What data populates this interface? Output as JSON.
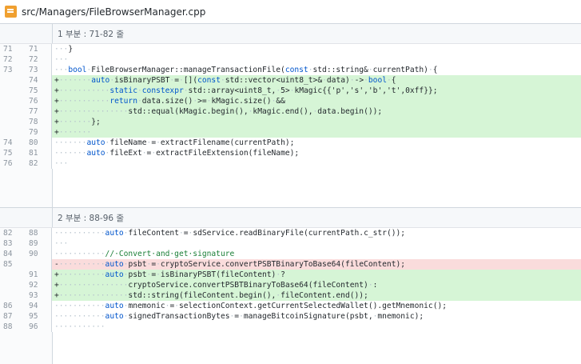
{
  "file": {
    "path": "src/Managers/FileBrowserManager.cpp"
  },
  "hunks": [
    {
      "title": "1 부분 : 71-82 줄",
      "rows": [
        {
          "old": "71",
          "new": "71",
          "type": "ctx",
          "code": "···}"
        },
        {
          "old": "72",
          "new": "72",
          "type": "ctx",
          "code": "···"
        },
        {
          "old": "73",
          "new": "73",
          "type": "ctx",
          "code": "···bool·FileBrowserManager::manageTransactionFile(const·std::string&·currentPath)·{"
        },
        {
          "old": "",
          "new": "74",
          "type": "add",
          "code": "+·······auto·isBinaryPSBT·=·[](const·std::vector<uint8_t>&·data)·->·bool·{"
        },
        {
          "old": "",
          "new": "75",
          "type": "add",
          "code": "+···········static·constexpr·std::array<uint8_t,·5>·kMagic{{'p','s','b','t',0xff}};"
        },
        {
          "old": "",
          "new": "76",
          "type": "add",
          "code": "+···········return·data.size()·>=·kMagic.size()·&&"
        },
        {
          "old": "",
          "new": "77",
          "type": "add",
          "code": "+···············std::equal(kMagic.begin(),·kMagic.end(),·data.begin());"
        },
        {
          "old": "",
          "new": "78",
          "type": "add",
          "code": "+·······};"
        },
        {
          "old": "",
          "new": "79",
          "type": "add",
          "code": "+·······"
        },
        {
          "old": "74",
          "new": "80",
          "type": "ctx",
          "code": "·······auto·fileName·=·extractFilename(currentPath);"
        },
        {
          "old": "75",
          "new": "81",
          "type": "ctx",
          "code": "·······auto·fileExt·=·extractFileExtension(fileName);"
        },
        {
          "old": "76",
          "new": "82",
          "type": "ctx",
          "code": "···"
        }
      ]
    },
    {
      "title": "2 부분 : 88-96 줄",
      "rows": [
        {
          "old": "82",
          "new": "88",
          "type": "ctx",
          "code": "···········auto·fileContent·=·sdService.readBinaryFile(currentPath.c_str());"
        },
        {
          "old": "83",
          "new": "89",
          "type": "ctx",
          "code": "···"
        },
        {
          "old": "84",
          "new": "90",
          "type": "ctx",
          "code": "···········//·Convert·and·get·signature"
        },
        {
          "old": "85",
          "new": "",
          "type": "del",
          "code": "-··········auto·psbt·=·cryptoService.convertPSBTBinaryToBase64(fileContent);"
        },
        {
          "old": "",
          "new": "91",
          "type": "add",
          "code": "+··········auto·psbt·=·isBinaryPSBT(fileContent)·?"
        },
        {
          "old": "",
          "new": "92",
          "type": "add",
          "code": "+···············cryptoService.convertPSBTBinaryToBase64(fileContent)·:"
        },
        {
          "old": "",
          "new": "93",
          "type": "add",
          "code": "+···············std::string(fileContent.begin(),·fileContent.end());"
        },
        {
          "old": "86",
          "new": "94",
          "type": "ctx",
          "code": "···········auto·mnemonic·=·selectionContext.getCurrentSelectedWallet().getMnemonic();"
        },
        {
          "old": "87",
          "new": "95",
          "type": "ctx",
          "code": "···········auto·signedTransactionBytes·=·manageBitcoinSignature(psbt,·mnemonic);"
        },
        {
          "old": "88",
          "new": "96",
          "type": "ctx",
          "code": "···········"
        }
      ]
    }
  ],
  "colors": {
    "add_bg": "#d6f5d6",
    "del_bg": "#fadcdc",
    "keyword": "#0055cc",
    "comment": "#1a7f37"
  }
}
